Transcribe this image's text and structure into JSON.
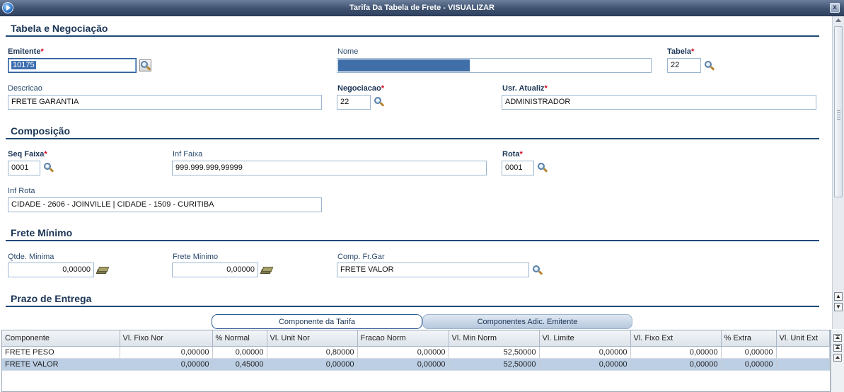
{
  "window": {
    "title": "Tarifa Da Tabela de Frete - VISUALIZAR",
    "close_label": "x"
  },
  "sections": {
    "tabela": "Tabela e Negociação",
    "composicao": "Composição",
    "frete_minimo": "Frete Mínimo",
    "prazo": "Prazo de Entrega"
  },
  "fields": {
    "emitente": {
      "label": "Emitente",
      "value": "10175",
      "required": true
    },
    "nome": {
      "label": "Nome",
      "value": ""
    },
    "tabela": {
      "label": "Tabela",
      "value": "22",
      "required": true
    },
    "descricao": {
      "label": "Descricao",
      "value": "FRETE GARANTIA"
    },
    "negociacao": {
      "label": "Negociacao",
      "value": "22",
      "required": true
    },
    "usr_atualiz": {
      "label": "Usr. Atualiz",
      "value": "ADMINISTRADOR",
      "required": true
    },
    "seq_faixa": {
      "label": "Seq Faixa",
      "value": "0001",
      "required": true
    },
    "inf_faixa": {
      "label": "Inf Faixa",
      "value": "999.999.999,99999"
    },
    "rota": {
      "label": "Rota",
      "value": "0001",
      "required": true
    },
    "inf_rota": {
      "label": "Inf Rota",
      "value": "CIDADE - 2606 - JOINVILLE | CIDADE - 1509 - CURITIBA"
    },
    "qtde_minima": {
      "label": "Qtde. Minima",
      "value": "0,00000"
    },
    "frete_minimo": {
      "label": "Frete Minimo",
      "value": "0,00000"
    },
    "comp_fr_gar": {
      "label": "Comp. Fr.Gar",
      "value": "FRETE VALOR"
    }
  },
  "required_mark": "*",
  "tabs": [
    {
      "label": "Componente da Tarifa",
      "active": true
    },
    {
      "label": "Componentes Adic. Emitente",
      "active": false
    }
  ],
  "grid": {
    "columns": [
      "Componente",
      "Vl. Fixo Nor",
      "% Normal",
      "Vl. Unit Nor",
      "Fracao Norm",
      "Vl. Min Norm",
      "Vl. Limite",
      "Vl. Fixo Ext",
      "% Extra",
      "Vl. Unit Ext"
    ],
    "rows": [
      [
        "FRETE PESO",
        "0,00000",
        "0,00000",
        "0,80000",
        "0,00000",
        "52,50000",
        "0,00000",
        "0,00000",
        "0,00000",
        ""
      ],
      [
        "FRETE VALOR",
        "0,00000",
        "0,45000",
        "0,00000",
        "0,00000",
        "52,50000",
        "0,00000",
        "0,00000",
        "0,00000",
        ""
      ]
    ],
    "selected_row": 1
  }
}
